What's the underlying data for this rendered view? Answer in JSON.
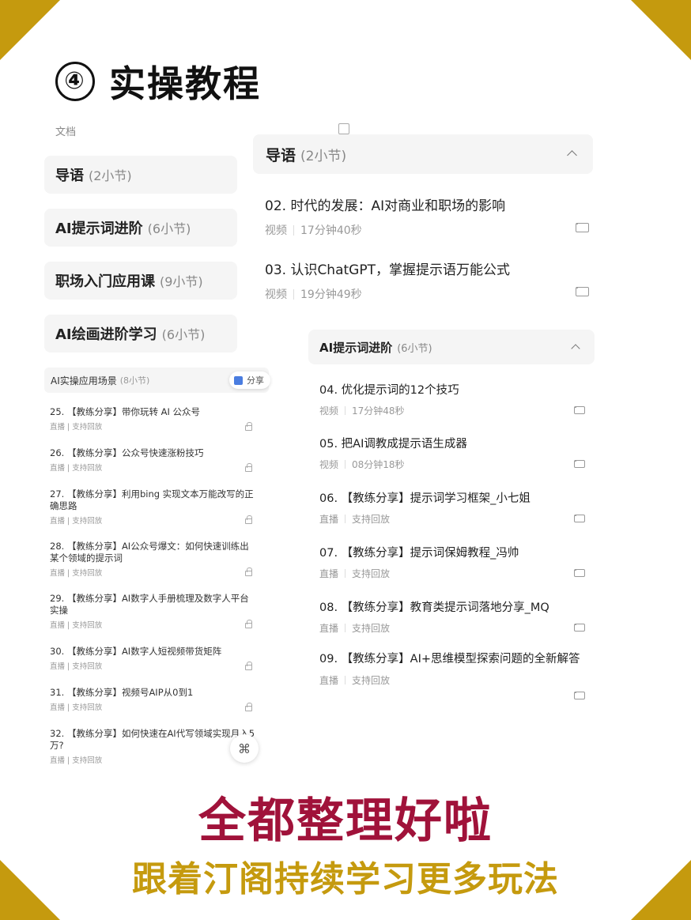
{
  "hero": {
    "num": "④",
    "title": "实操教程"
  },
  "doc_label": "文档",
  "left_sections": [
    {
      "title": "导语",
      "count": "(2小节)"
    },
    {
      "title": "AI提示词进阶",
      "count": "(6小节)"
    },
    {
      "title": "职场入门应用课",
      "count": "(9小节)"
    },
    {
      "title": "AI绘画进阶学习",
      "count": "(6小节)"
    }
  ],
  "mini_list": {
    "title": "AI实操应用场景",
    "count": "(8小节)",
    "share": "分享",
    "items": [
      {
        "title": "25. 【教练分享】带你玩转 AI 公众号",
        "type": "直播",
        "status": "支持回放"
      },
      {
        "title": "26. 【教练分享】公众号快速涨粉技巧",
        "type": "直播",
        "status": "支持回放"
      },
      {
        "title": "27. 【教练分享】利用bing 实现文本万能改写的正确思路",
        "type": "直播",
        "status": "支持回放"
      },
      {
        "title": "28. 【教练分享】AI公众号爆文：如何快速训练出某个领域的提示词",
        "type": "直播",
        "status": "支持回放"
      },
      {
        "title": "29. 【教练分享】AI数字人手册梳理及数字人平台实操",
        "type": "直播",
        "status": "支持回放"
      },
      {
        "title": "30. 【教练分享】AI数字人短视频带货矩阵",
        "type": "直播",
        "status": "支持回放"
      },
      {
        "title": "31. 【教练分享】视频号AIP从0到1",
        "type": "直播",
        "status": "支持回放"
      },
      {
        "title": "32. 【教练分享】如何快速在AI代写领域实现月入5万?",
        "type": "直播",
        "status": "支持回放"
      }
    ]
  },
  "card1": {
    "title": "导语",
    "count": "(2小节)",
    "items": [
      {
        "title": "02. 时代的发展：AI对商业和职场的影响",
        "type": "视频",
        "duration": "17分钟40秒"
      },
      {
        "title": "03. 认识ChatGPT，掌握提示语万能公式",
        "type": "视频",
        "duration": "19分钟49秒"
      }
    ]
  },
  "card2": {
    "title": "AI提示词进阶",
    "count": "(6小节)",
    "items": [
      {
        "title": "04. 优化提示词的12个技巧",
        "type": "视频",
        "duration": "17分钟48秒"
      },
      {
        "title": "05. 把AI调教成提示语生成器",
        "type": "视频",
        "duration": "08分钟18秒"
      },
      {
        "title": "06. 【教练分享】提示词学习框架_小七姐",
        "type": "直播",
        "duration": "支持回放"
      },
      {
        "title": "07. 【教练分享】提示词保姆教程_冯帅",
        "type": "直播",
        "duration": "支持回放"
      },
      {
        "title": "08. 【教练分享】教育类提示词落地分享_MQ",
        "type": "直播",
        "duration": "支持回放"
      },
      {
        "title": "09. 【教练分享】AI+思维模型探索问题的全新解答",
        "type": "直播",
        "duration": "支持回放"
      }
    ]
  },
  "footer": {
    "line1": "全都整理好啦",
    "line2": "跟着汀阁持续学习更多玩法"
  },
  "colors": {
    "gold": "#c59a0e",
    "crimson": "#a0123a",
    "panel": "#f5f5f5"
  }
}
